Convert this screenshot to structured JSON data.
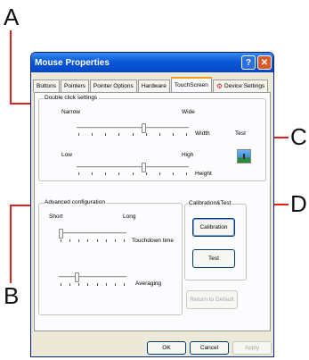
{
  "window": {
    "title": "Mouse Properties",
    "help_glyph": "?",
    "close_glyph": "✕"
  },
  "tabs": [
    {
      "label": "Buttons"
    },
    {
      "label": "Pointers"
    },
    {
      "label": "Pointer Options"
    },
    {
      "label": "Hardware"
    },
    {
      "label": "TouchScreen",
      "active": true
    },
    {
      "label": "Device Settings"
    }
  ],
  "double_click": {
    "title": "Double click settings",
    "narrow": "Narrow",
    "wide": "Wide",
    "width": "Width",
    "low": "Low",
    "high": "High",
    "height": "Height",
    "test": "Test",
    "width_level": 0.6,
    "height_level": 0.6
  },
  "advanced": {
    "title": "Advanced configuration",
    "short": "Short",
    "long": "Long",
    "touchdown": "Touchdown time",
    "averaging": "Averaging",
    "touchdown_level": 0.0,
    "averaging_level": 0.25
  },
  "calibration": {
    "title": "Calibration&Test",
    "calibration_btn": "Calibration",
    "test_btn": "Test",
    "return_btn": "Return to Default"
  },
  "buttons": {
    "ok": "OK",
    "cancel": "Cancel",
    "apply": "Apply"
  },
  "callouts": {
    "a": "A",
    "b": "B",
    "c": "C",
    "d": "D"
  },
  "colors": {
    "callout_line": "#e02020",
    "titlebar": "#0a58d6",
    "active_tab_accent": "#f0a020"
  }
}
